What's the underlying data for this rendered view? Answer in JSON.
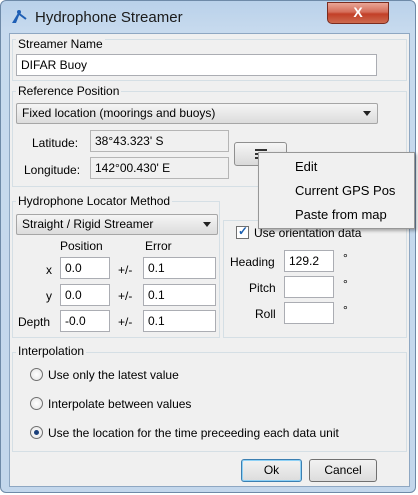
{
  "window": {
    "title": "Hydrophone Streamer",
    "close_label": "X"
  },
  "streamer_name": {
    "group_label": "Streamer Name",
    "value": "DIFAR Buoy"
  },
  "reference_position": {
    "group_label": "Reference Position",
    "method": "Fixed location (moorings and buoys)",
    "latitude_label": "Latitude:",
    "latitude": "38°43.323' S",
    "longitude_label": "Longitude:",
    "longitude": "142°00.430' E"
  },
  "popup_menu": {
    "items": [
      "Edit",
      "Current GPS Pos",
      "Paste from map"
    ]
  },
  "locator": {
    "group_label": "Hydrophone Locator Method",
    "method": "Straight / Rigid Streamer",
    "position_header": "Position",
    "error_header": "Error",
    "rows": [
      {
        "label": "x",
        "position": "0.0",
        "pm": "+/-",
        "error": "0.1"
      },
      {
        "label": "y",
        "position": "0.0",
        "pm": "+/-",
        "error": "0.1"
      },
      {
        "label": "Depth",
        "position": "-0.0",
        "pm": "+/-",
        "error": "0.1"
      }
    ]
  },
  "orientation": {
    "checkbox_label": "Use orientation data",
    "checked": true,
    "heading_label": "Heading",
    "heading": "129.2",
    "pitch_label": "Pitch",
    "pitch": "",
    "roll_label": "Roll",
    "roll": "",
    "degree": "°"
  },
  "interpolation": {
    "group_label": "Interpolation",
    "options": [
      "Use only the latest value",
      "Interpolate between values",
      "Use the location for the time preceeding each data unit"
    ],
    "selected_index": 2
  },
  "buttons": {
    "ok": "Ok",
    "cancel": "Cancel"
  }
}
